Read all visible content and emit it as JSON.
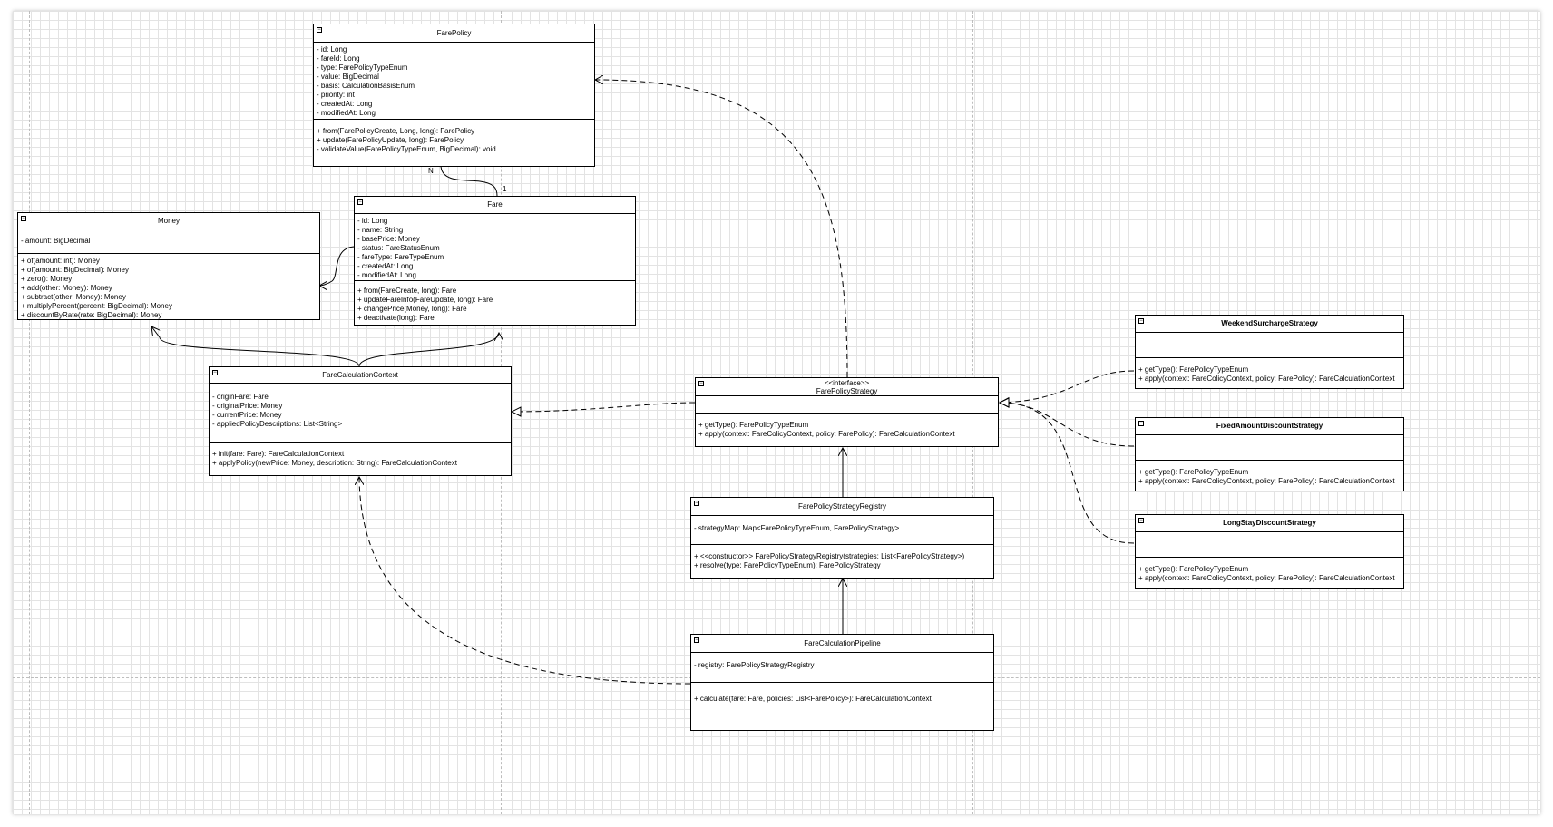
{
  "classes": {
    "farePolicy": {
      "name": "FarePolicy",
      "attributes": [
        "- id: Long",
        "- fareId: Long",
        "- type: FarePolicyTypeEnum",
        "- value: BigDecimal",
        "- basis: CalculationBasisEnum",
        "- priority: int",
        "- createdAt: Long",
        "- modifiedAt: Long"
      ],
      "methods": [
        "+ from(FarePolicyCreate, Long, long): FarePolicy",
        "+ update(FarePolicyUpdate, long): FarePolicy",
        "- validateValue(FarePolicyTypeEnum, BigDecimal): void"
      ]
    },
    "fare": {
      "name": "Fare",
      "attributes": [
        "- id: Long",
        "- name: String",
        "- basePrice: Money",
        "- status: FareStatusEnum",
        "- fareType: FareTypeEnum",
        "- createdAt: Long",
        "- modifiedAt: Long"
      ],
      "methods": [
        "+ from(FareCreate, long): Fare",
        "+ updateFareInfo(FareUpdate, long): Fare",
        "+ changePrice(Money, long): Fare",
        "+ deactivate(long): Fare"
      ]
    },
    "money": {
      "name": "Money",
      "attributes": [
        "- amount: BigDecimal"
      ],
      "methods": [
        "+ of(amount: int): Money",
        "+ of(amount: BigDecimal): Money",
        "+ zero(): Money",
        "+ add(other: Money): Money",
        "+ subtract(other: Money): Money",
        "+ multiplyPercent(percent: BigDecimal): Money",
        "+ discountByRate(rate: BigDecimal): Money"
      ]
    },
    "fareCalculationContext": {
      "name": "FareCalculationContext",
      "attributes": [
        "- originFare: Fare",
        "- originalPrice: Money",
        "- currentPrice: Money",
        "- appliedPolicyDescriptions: List<String>"
      ],
      "methods": [
        "+ init(fare: Fare): FareCalculationContext",
        "+ applyPolicy(newPrice: Money, description: String): FareCalculationContext"
      ]
    },
    "farePolicyStrategy": {
      "stereotype": "<<interface>>",
      "name": "FarePolicyStrategy",
      "methods": [
        "+ getType(): FarePolicyTypeEnum",
        "+ apply(context: FareColicyContext, policy: FarePolicy): FareCalculationContext"
      ]
    },
    "registry": {
      "name": "FarePolicyStrategyRegistry",
      "attributes": [
        "- strategyMap: Map<FarePolicyTypeEnum, FarePolicyStrategy>"
      ],
      "methods": [
        "+ <<constructor>> FarePolicyStrategyRegistry(strategies: List<FarePolicyStrategy>)",
        "+ resolve(type: FarePolicyTypeEnum): FarePolicyStrategy"
      ]
    },
    "pipeline": {
      "name": "FareCalculationPipeline",
      "attributes": [
        "- registry: FarePolicyStrategyRegistry"
      ],
      "methods": [
        "+ calculate(fare: Fare, policies: List<FarePolicy>): FareCalculationContext"
      ]
    },
    "weekend": {
      "name": "WeekendSurchargeStrategy",
      "methods": [
        "+ getType(): FarePolicyTypeEnum",
        "+ apply(context: FareColicyContext, policy: FarePolicy): FareCalculationContext"
      ]
    },
    "fixed": {
      "name": "FixedAmountDiscountStrategy",
      "methods": [
        "+ getType(): FarePolicyTypeEnum",
        "+ apply(context: FareColicyContext, policy: FarePolicy): FareCalculationContext"
      ]
    },
    "longstay": {
      "name": "LongStayDiscountStrategy",
      "methods": [
        "+ getType(): FarePolicyTypeEnum",
        "+ apply(context: FareColicyContext, policy: FarePolicy): FareCalculationContext"
      ]
    }
  },
  "multiplicity": {
    "policySide": "N",
    "fareSide": "1"
  },
  "icons": {
    "collapse": "collapse-icon"
  },
  "colors": {
    "grid": "#e3e3e3",
    "line": "#000000",
    "dashedGuide": "#bdbdbd"
  }
}
